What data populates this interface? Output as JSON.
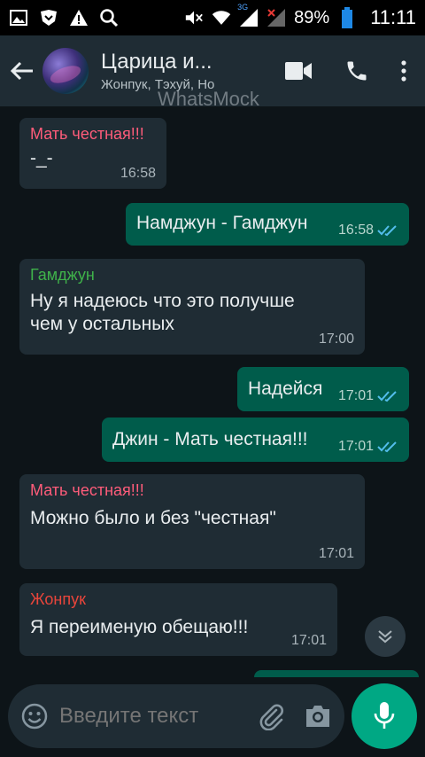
{
  "status_bar": {
    "battery": "89%",
    "time": "11:11",
    "net_badge": "3G",
    "icons": [
      "image-icon",
      "shield-icon",
      "warning-icon",
      "search-icon",
      "mute-icon",
      "wifi-icon",
      "signal-icon",
      "signal-off-icon",
      "battery-icon"
    ]
  },
  "header": {
    "title": "Царица и...",
    "subtitle": "Жонпук, Тэхуй, Но",
    "watermark": "WhatsMock"
  },
  "messages": [
    {
      "dir": "in",
      "sender": "Мать честная!!!",
      "sender_color": "#ff5c7a",
      "text": "-_-",
      "time": "16:58"
    },
    {
      "dir": "out",
      "text": "Намджун - Гамджун",
      "time": "16:58",
      "ticks": "read"
    },
    {
      "dir": "in",
      "sender": "Гамджун",
      "sender_color": "#3fb24a",
      "text_line1": "Ну я надеюсь что это получше",
      "text_line2": "чем у остальных",
      "time": "17:00"
    },
    {
      "dir": "out",
      "text": "Надейся",
      "time": "17:01",
      "ticks": "read"
    },
    {
      "dir": "out",
      "text": "Джин - Мать честная!!!",
      "time": "17:01",
      "ticks": "read"
    },
    {
      "dir": "in",
      "sender": "Мать честная!!!",
      "sender_color": "#ff5c7a",
      "text": "Можно было и без \"честная\"",
      "time": "17:01"
    },
    {
      "dir": "in",
      "sender": "Жонпук",
      "sender_color": "#e9453b",
      "text": "Я переименую обещаю!!!",
      "time": "17:01"
    }
  ],
  "input": {
    "placeholder": "Введите текст"
  },
  "colors": {
    "header_bg": "#1f2c34",
    "incoming_bubble": "#1f2c34",
    "outgoing_bubble": "#005c4b",
    "accent": "#00a884",
    "read_ticks": "#53bdeb"
  }
}
